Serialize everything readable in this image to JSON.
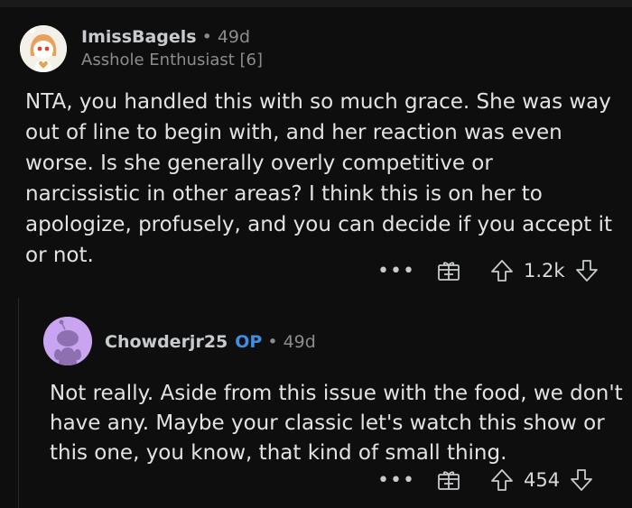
{
  "comment": {
    "username": "ImissBagels",
    "separator": "•",
    "age": "49d",
    "flair": "Asshole Enthusiast [6]",
    "body": "NTA, you handled this with so much grace. She was way out of line to begin with, and her reaction was even worse. Is she generally overly competitive or narcissistic in other areas? I think this is on her to apologize, profusely, and you can decide if you accept it or not.",
    "more_label": "•••",
    "score": "1.2k"
  },
  "reply": {
    "username": "Chowderjr25",
    "op_badge": "OP",
    "separator": "•",
    "age": "49d",
    "body": "Not really. Aside from this issue with the food, we don't have any. Maybe your classic let's watch this show or this one, you know, that kind of small thing.",
    "more_label": "•••",
    "score": "454"
  },
  "colors": {
    "background": "#0e0e0f",
    "op_badge": "#3f8fe0",
    "reply_avatar_bg": "#c9a4f0",
    "text": "#e1e3e5",
    "muted": "#8a8c8e"
  },
  "icons": {
    "more": "more-icon",
    "award": "gift-award-icon",
    "upvote": "upvote-arrow-icon",
    "downvote": "downvote-arrow-icon"
  }
}
